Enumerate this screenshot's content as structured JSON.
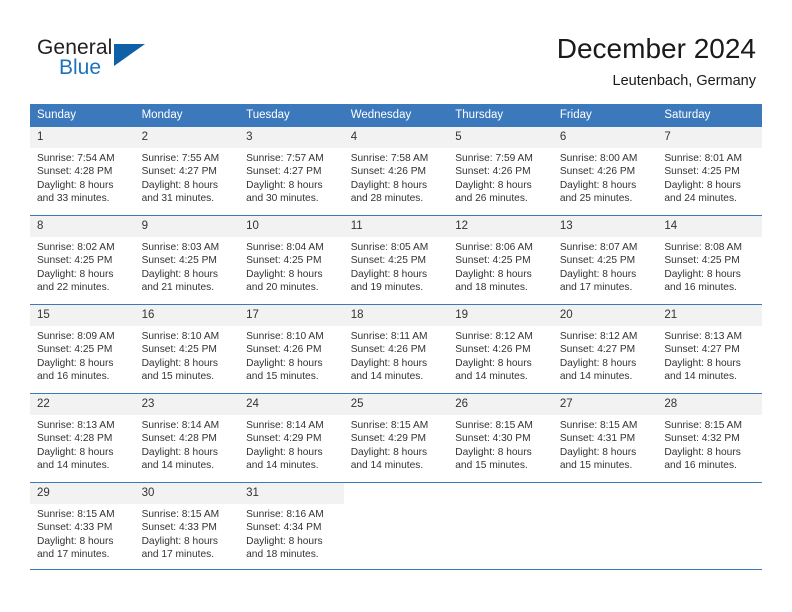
{
  "brand": {
    "name_part1": "General",
    "name_part2": "Blue",
    "accent_color": "#1e73be",
    "triangle_color": "#1060a8"
  },
  "header": {
    "title": "December 2024",
    "subtitle": "Leutenbach, Germany"
  },
  "calendar": {
    "header_background": "#3b79bc",
    "header_text_color": "#ffffff",
    "daynum_background": "#f2f2f2",
    "weekdays": [
      "Sunday",
      "Monday",
      "Tuesday",
      "Wednesday",
      "Thursday",
      "Friday",
      "Saturday"
    ],
    "weeks": [
      [
        {
          "day": "1",
          "sunrise": "Sunrise: 7:54 AM",
          "sunset": "Sunset: 4:28 PM",
          "daylight_line1": "Daylight: 8 hours",
          "daylight_line2": "and 33 minutes."
        },
        {
          "day": "2",
          "sunrise": "Sunrise: 7:55 AM",
          "sunset": "Sunset: 4:27 PM",
          "daylight_line1": "Daylight: 8 hours",
          "daylight_line2": "and 31 minutes."
        },
        {
          "day": "3",
          "sunrise": "Sunrise: 7:57 AM",
          "sunset": "Sunset: 4:27 PM",
          "daylight_line1": "Daylight: 8 hours",
          "daylight_line2": "and 30 minutes."
        },
        {
          "day": "4",
          "sunrise": "Sunrise: 7:58 AM",
          "sunset": "Sunset: 4:26 PM",
          "daylight_line1": "Daylight: 8 hours",
          "daylight_line2": "and 28 minutes."
        },
        {
          "day": "5",
          "sunrise": "Sunrise: 7:59 AM",
          "sunset": "Sunset: 4:26 PM",
          "daylight_line1": "Daylight: 8 hours",
          "daylight_line2": "and 26 minutes."
        },
        {
          "day": "6",
          "sunrise": "Sunrise: 8:00 AM",
          "sunset": "Sunset: 4:26 PM",
          "daylight_line1": "Daylight: 8 hours",
          "daylight_line2": "and 25 minutes."
        },
        {
          "day": "7",
          "sunrise": "Sunrise: 8:01 AM",
          "sunset": "Sunset: 4:25 PM",
          "daylight_line1": "Daylight: 8 hours",
          "daylight_line2": "and 24 minutes."
        }
      ],
      [
        {
          "day": "8",
          "sunrise": "Sunrise: 8:02 AM",
          "sunset": "Sunset: 4:25 PM",
          "daylight_line1": "Daylight: 8 hours",
          "daylight_line2": "and 22 minutes."
        },
        {
          "day": "9",
          "sunrise": "Sunrise: 8:03 AM",
          "sunset": "Sunset: 4:25 PM",
          "daylight_line1": "Daylight: 8 hours",
          "daylight_line2": "and 21 minutes."
        },
        {
          "day": "10",
          "sunrise": "Sunrise: 8:04 AM",
          "sunset": "Sunset: 4:25 PM",
          "daylight_line1": "Daylight: 8 hours",
          "daylight_line2": "and 20 minutes."
        },
        {
          "day": "11",
          "sunrise": "Sunrise: 8:05 AM",
          "sunset": "Sunset: 4:25 PM",
          "daylight_line1": "Daylight: 8 hours",
          "daylight_line2": "and 19 minutes."
        },
        {
          "day": "12",
          "sunrise": "Sunrise: 8:06 AM",
          "sunset": "Sunset: 4:25 PM",
          "daylight_line1": "Daylight: 8 hours",
          "daylight_line2": "and 18 minutes."
        },
        {
          "day": "13",
          "sunrise": "Sunrise: 8:07 AM",
          "sunset": "Sunset: 4:25 PM",
          "daylight_line1": "Daylight: 8 hours",
          "daylight_line2": "and 17 minutes."
        },
        {
          "day": "14",
          "sunrise": "Sunrise: 8:08 AM",
          "sunset": "Sunset: 4:25 PM",
          "daylight_line1": "Daylight: 8 hours",
          "daylight_line2": "and 16 minutes."
        }
      ],
      [
        {
          "day": "15",
          "sunrise": "Sunrise: 8:09 AM",
          "sunset": "Sunset: 4:25 PM",
          "daylight_line1": "Daylight: 8 hours",
          "daylight_line2": "and 16 minutes."
        },
        {
          "day": "16",
          "sunrise": "Sunrise: 8:10 AM",
          "sunset": "Sunset: 4:25 PM",
          "daylight_line1": "Daylight: 8 hours",
          "daylight_line2": "and 15 minutes."
        },
        {
          "day": "17",
          "sunrise": "Sunrise: 8:10 AM",
          "sunset": "Sunset: 4:26 PM",
          "daylight_line1": "Daylight: 8 hours",
          "daylight_line2": "and 15 minutes."
        },
        {
          "day": "18",
          "sunrise": "Sunrise: 8:11 AM",
          "sunset": "Sunset: 4:26 PM",
          "daylight_line1": "Daylight: 8 hours",
          "daylight_line2": "and 14 minutes."
        },
        {
          "day": "19",
          "sunrise": "Sunrise: 8:12 AM",
          "sunset": "Sunset: 4:26 PM",
          "daylight_line1": "Daylight: 8 hours",
          "daylight_line2": "and 14 minutes."
        },
        {
          "day": "20",
          "sunrise": "Sunrise: 8:12 AM",
          "sunset": "Sunset: 4:27 PM",
          "daylight_line1": "Daylight: 8 hours",
          "daylight_line2": "and 14 minutes."
        },
        {
          "day": "21",
          "sunrise": "Sunrise: 8:13 AM",
          "sunset": "Sunset: 4:27 PM",
          "daylight_line1": "Daylight: 8 hours",
          "daylight_line2": "and 14 minutes."
        }
      ],
      [
        {
          "day": "22",
          "sunrise": "Sunrise: 8:13 AM",
          "sunset": "Sunset: 4:28 PM",
          "daylight_line1": "Daylight: 8 hours",
          "daylight_line2": "and 14 minutes."
        },
        {
          "day": "23",
          "sunrise": "Sunrise: 8:14 AM",
          "sunset": "Sunset: 4:28 PM",
          "daylight_line1": "Daylight: 8 hours",
          "daylight_line2": "and 14 minutes."
        },
        {
          "day": "24",
          "sunrise": "Sunrise: 8:14 AM",
          "sunset": "Sunset: 4:29 PM",
          "daylight_line1": "Daylight: 8 hours",
          "daylight_line2": "and 14 minutes."
        },
        {
          "day": "25",
          "sunrise": "Sunrise: 8:15 AM",
          "sunset": "Sunset: 4:29 PM",
          "daylight_line1": "Daylight: 8 hours",
          "daylight_line2": "and 14 minutes."
        },
        {
          "day": "26",
          "sunrise": "Sunrise: 8:15 AM",
          "sunset": "Sunset: 4:30 PM",
          "daylight_line1": "Daylight: 8 hours",
          "daylight_line2": "and 15 minutes."
        },
        {
          "day": "27",
          "sunrise": "Sunrise: 8:15 AM",
          "sunset": "Sunset: 4:31 PM",
          "daylight_line1": "Daylight: 8 hours",
          "daylight_line2": "and 15 minutes."
        },
        {
          "day": "28",
          "sunrise": "Sunrise: 8:15 AM",
          "sunset": "Sunset: 4:32 PM",
          "daylight_line1": "Daylight: 8 hours",
          "daylight_line2": "and 16 minutes."
        }
      ],
      [
        {
          "day": "29",
          "sunrise": "Sunrise: 8:15 AM",
          "sunset": "Sunset: 4:33 PM",
          "daylight_line1": "Daylight: 8 hours",
          "daylight_line2": "and 17 minutes."
        },
        {
          "day": "30",
          "sunrise": "Sunrise: 8:15 AM",
          "sunset": "Sunset: 4:33 PM",
          "daylight_line1": "Daylight: 8 hours",
          "daylight_line2": "and 17 minutes."
        },
        {
          "day": "31",
          "sunrise": "Sunrise: 8:16 AM",
          "sunset": "Sunset: 4:34 PM",
          "daylight_line1": "Daylight: 8 hours",
          "daylight_line2": "and 18 minutes."
        },
        {
          "day": "",
          "sunrise": "",
          "sunset": "",
          "daylight_line1": "",
          "daylight_line2": ""
        },
        {
          "day": "",
          "sunrise": "",
          "sunset": "",
          "daylight_line1": "",
          "daylight_line2": ""
        },
        {
          "day": "",
          "sunrise": "",
          "sunset": "",
          "daylight_line1": "",
          "daylight_line2": ""
        },
        {
          "day": "",
          "sunrise": "",
          "sunset": "",
          "daylight_line1": "",
          "daylight_line2": ""
        }
      ]
    ]
  }
}
